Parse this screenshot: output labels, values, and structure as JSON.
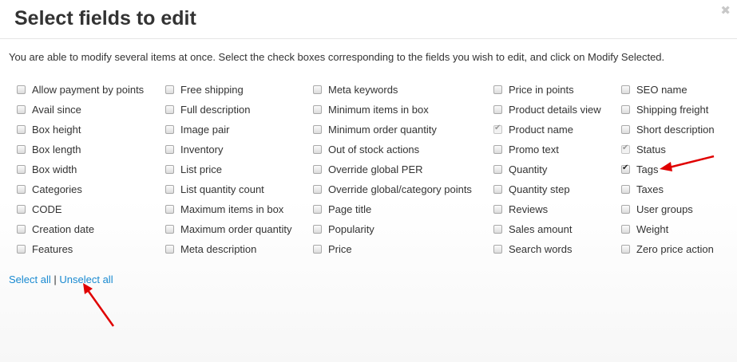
{
  "dialog": {
    "title": "Select fields to edit",
    "close_icon": "close-icon",
    "close_glyph": "✖"
  },
  "instructions": "You are able to modify several items at once. Select the check boxes corresponding to the fields you wish to edit, and click on Modify Selected.",
  "columns": [
    [
      {
        "label": "Allow payment by points",
        "checked": false
      },
      {
        "label": "Avail since",
        "checked": false
      },
      {
        "label": "Box height",
        "checked": false
      },
      {
        "label": "Box length",
        "checked": false
      },
      {
        "label": "Box width",
        "checked": false
      },
      {
        "label": "Categories",
        "checked": false
      },
      {
        "label": "CODE",
        "checked": false
      },
      {
        "label": "Creation date",
        "checked": false
      },
      {
        "label": "Features",
        "checked": false
      }
    ],
    [
      {
        "label": "Free shipping",
        "checked": false
      },
      {
        "label": "Full description",
        "checked": false
      },
      {
        "label": "Image pair",
        "checked": false
      },
      {
        "label": "Inventory",
        "checked": false
      },
      {
        "label": "List price",
        "checked": false
      },
      {
        "label": "List quantity count",
        "checked": false
      },
      {
        "label": "Maximum items in box",
        "checked": false
      },
      {
        "label": "Maximum order quantity",
        "checked": false
      },
      {
        "label": "Meta description",
        "checked": false
      }
    ],
    [
      {
        "label": "Meta keywords",
        "checked": false
      },
      {
        "label": "Minimum items in box",
        "checked": false
      },
      {
        "label": "Minimum order quantity",
        "checked": false
      },
      {
        "label": "Out of stock actions",
        "checked": false
      },
      {
        "label": "Override global PER",
        "checked": false
      },
      {
        "label": "Override global/category points",
        "checked": false
      },
      {
        "label": "Page title",
        "checked": false
      },
      {
        "label": "Popularity",
        "checked": false
      },
      {
        "label": "Price",
        "checked": false
      }
    ],
    [
      {
        "label": "Price in points",
        "checked": false
      },
      {
        "label": "Product details view",
        "checked": false
      },
      {
        "label": "Product name",
        "checked": true,
        "disabled": true
      },
      {
        "label": "Promo text",
        "checked": false
      },
      {
        "label": "Quantity",
        "checked": false
      },
      {
        "label": "Quantity step",
        "checked": false
      },
      {
        "label": "Reviews",
        "checked": false
      },
      {
        "label": "Sales amount",
        "checked": false
      },
      {
        "label": "Search words",
        "checked": false
      }
    ],
    [
      {
        "label": "SEO name",
        "checked": false
      },
      {
        "label": "Shipping freight",
        "checked": false
      },
      {
        "label": "Short description",
        "checked": false
      },
      {
        "label": "Status",
        "checked": true,
        "disabled": true
      },
      {
        "label": "Tags",
        "checked": true
      },
      {
        "label": "Taxes",
        "checked": false
      },
      {
        "label": "User groups",
        "checked": false
      },
      {
        "label": "Weight",
        "checked": false
      },
      {
        "label": "Zero price action",
        "checked": false
      }
    ]
  ],
  "links": {
    "select_all": "Select all",
    "separator": "|",
    "unselect_all": "Unselect all"
  },
  "colors": {
    "link": "#1a8ad1",
    "annotation_arrow": "#e00000"
  }
}
